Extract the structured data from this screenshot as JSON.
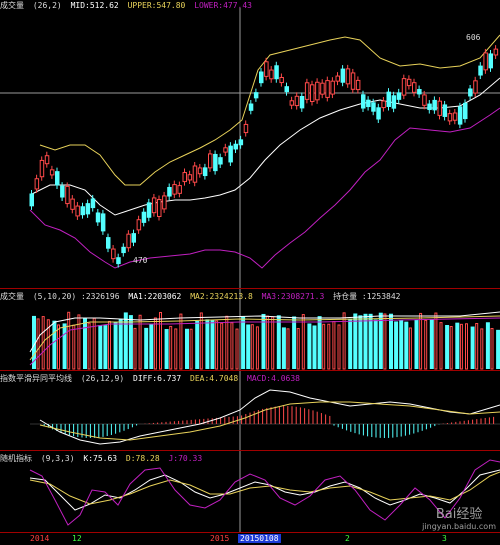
{
  "colors": {
    "up": "#ff4a4a",
    "down": "#54ffff",
    "boll_upper": "#e8d25a",
    "boll_mid": "#ffffff",
    "boll_lower": "#c020c0",
    "separator": "#a00000",
    "crosshair": "#9a9a9a",
    "date_highlight_bg": "#1d3bd8"
  },
  "main": {
    "indicator_name": "成交量",
    "header_params": "(26,2)",
    "header_mid": "MID:512.62",
    "header_upper": "UPPER:547.80",
    "header_lower": "LOWER:477.43",
    "price_high_label": "606",
    "price_low_label": "470",
    "ylabel": "成交量"
  },
  "volume": {
    "title": "成交量",
    "params": "(5,10,20)",
    "vol": ":2326196",
    "ma1": "MA1:2203062",
    "ma2": "MA2:2324213.8",
    "ma3": "MA3:2308271.3",
    "hold_label": "持仓量",
    "hold_value": ":1253842"
  },
  "macd": {
    "title": "指数平滑异同平均线",
    "params": "(26,12,9)",
    "diff": "DIFF:6.737",
    "dea": "DEA:4.7048",
    "macd": "MACD:4.0638"
  },
  "kdj": {
    "title": "随机指标",
    "params": "(9,3,3)",
    "k": "K:75.63",
    "d": "D:78.28",
    "j": "J:70.33"
  },
  "xaxis": {
    "labels": [
      {
        "text": "2014",
        "color": "#ff4040"
      },
      {
        "text": "12",
        "color": "#40ff40"
      },
      {
        "text": "2015",
        "color": "#ff4040"
      },
      {
        "text": "20150108",
        "color": "#ffffff"
      },
      {
        "text": "2",
        "color": "#40ff40"
      },
      {
        "text": "3",
        "color": "#40ff40"
      }
    ]
  },
  "watermark": {
    "text": "Bai经验",
    "url": "jingyan.baidu.com"
  }
}
